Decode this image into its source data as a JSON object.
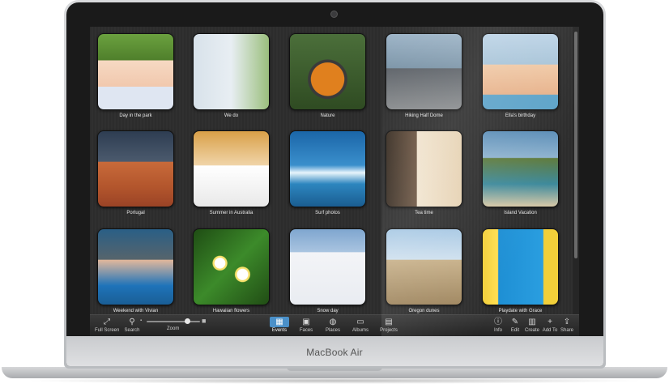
{
  "device": {
    "brand": "MacBook Air"
  },
  "albums": [
    {
      "name": "Day in the park",
      "photo": "photo-girl-flower"
    },
    {
      "name": "We do",
      "photo": "photo-couple"
    },
    {
      "name": "Nature",
      "photo": "photo-butterfly"
    },
    {
      "name": "Hiking Half Dome",
      "photo": "photo-cliff"
    },
    {
      "name": "Ella's birthday",
      "photo": "photo-kids"
    },
    {
      "name": "Portugal",
      "photo": "photo-town"
    },
    {
      "name": "Summer in Australia",
      "photo": "photo-boy-teddy"
    },
    {
      "name": "Surf photos",
      "photo": "photo-surf"
    },
    {
      "name": "Tea time",
      "photo": "photo-woman-cup"
    },
    {
      "name": "Island Vacation",
      "photo": "photo-coast"
    },
    {
      "name": "Weekend with Vivian",
      "photo": "photo-woman-smile"
    },
    {
      "name": "Hawaiian flowers",
      "photo": "photo-flowers"
    },
    {
      "name": "Snow day",
      "photo": "photo-snow-girl"
    },
    {
      "name": "Oregon dunes",
      "photo": "photo-two-girls"
    },
    {
      "name": "Playdate with Grace",
      "photo": "photo-girl-door"
    }
  ],
  "toolbar": {
    "left": [
      {
        "label": "Full Screen",
        "icon": "fullscreen-icon"
      },
      {
        "label": "Search",
        "icon": "search-icon"
      }
    ],
    "zoom": {
      "label": "Zoom",
      "value": 0.7
    },
    "center": [
      {
        "label": "Events",
        "icon": "events-icon",
        "active": true
      },
      {
        "label": "Faces",
        "icon": "faces-icon"
      },
      {
        "label": "Places",
        "icon": "places-icon"
      },
      {
        "label": "Albums",
        "icon": "albums-icon"
      },
      {
        "label": "Projects",
        "icon": "projects-icon"
      }
    ],
    "right": [
      {
        "label": "Info",
        "icon": "info-icon"
      },
      {
        "label": "Edit",
        "icon": "edit-icon"
      },
      {
        "label": "Create",
        "icon": "create-icon"
      },
      {
        "label": "Add To",
        "icon": "add-to-icon"
      },
      {
        "label": "Share",
        "icon": "share-icon"
      }
    ]
  },
  "colors": {
    "accent": "#4a90c9",
    "screen_bg": "#2e2e2e"
  }
}
